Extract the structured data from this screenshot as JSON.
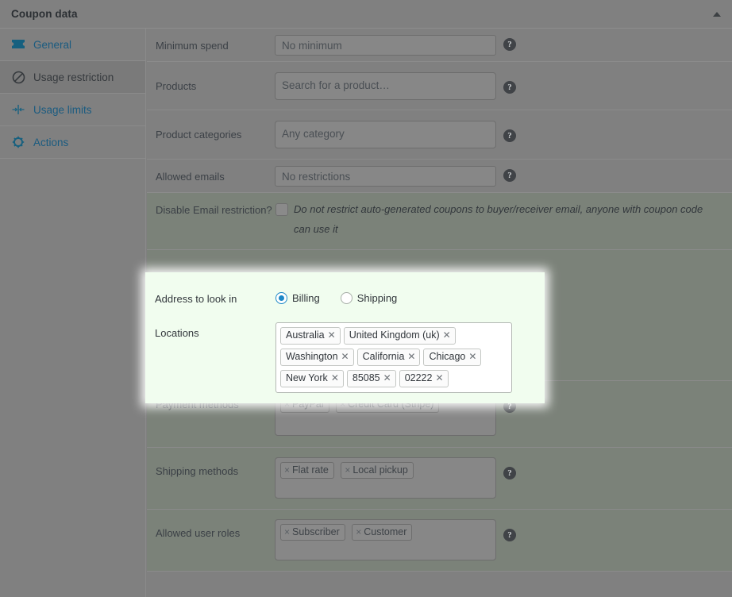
{
  "header": {
    "title": "Coupon data",
    "collapse_icon": "triangle-up-icon"
  },
  "sidebar": {
    "items": [
      {
        "label": "General",
        "icon": "ticket-icon",
        "active": false
      },
      {
        "label": "Usage restriction",
        "icon": "ban-icon",
        "active": true
      },
      {
        "label": "Usage limits",
        "icon": "limits-icon",
        "active": false
      },
      {
        "label": "Actions",
        "icon": "gear-icon",
        "active": false
      }
    ]
  },
  "form": {
    "help_glyph": "?",
    "rows": {
      "minimum_spend": {
        "label": "Minimum spend",
        "placeholder": "No minimum",
        "value": ""
      },
      "products": {
        "label": "Products",
        "placeholder": "Search for a product…",
        "value": ""
      },
      "product_categories": {
        "label": "Product categories",
        "placeholder": "Any category",
        "value": ""
      },
      "allowed_emails": {
        "label": "Allowed emails",
        "placeholder": "No restrictions",
        "value": ""
      },
      "disable_email_restriction": {
        "label": "Disable Email restriction?",
        "checkbox_checked": false,
        "description": "Do not restrict auto-generated coupons to buyer/receiver email, anyone with coupon code can use it"
      },
      "address_to_look_in": {
        "label": "Address to look in",
        "options": [
          {
            "label": "Billing",
            "selected": true
          },
          {
            "label": "Shipping",
            "selected": false
          }
        ]
      },
      "locations": {
        "label": "Locations",
        "tags": [
          "Australia",
          "United Kingdom (uk)",
          "Washington",
          "California",
          "Chicago",
          "New York",
          "85085",
          "02222"
        ],
        "remove_glyph": "✕"
      },
      "payment_methods": {
        "label": "Payment methods",
        "tags": [
          "PayPal",
          "Credit Card (Stripe)"
        ],
        "remove_glyph": "×"
      },
      "shipping_methods": {
        "label": "Shipping methods",
        "tags": [
          "Flat rate",
          "Local pickup"
        ],
        "remove_glyph": "×"
      },
      "allowed_user_roles": {
        "label": "Allowed user roles",
        "tags": [
          "Subscriber",
          "Customer"
        ],
        "remove_glyph": "×"
      }
    }
  },
  "colors": {
    "highlight_bg": "#f1fdef",
    "accent_link": "#1a5b80",
    "radio_accent": "#1e88c7",
    "panel_bg": "#808080",
    "tinted_row_bg": "#7b8279"
  }
}
